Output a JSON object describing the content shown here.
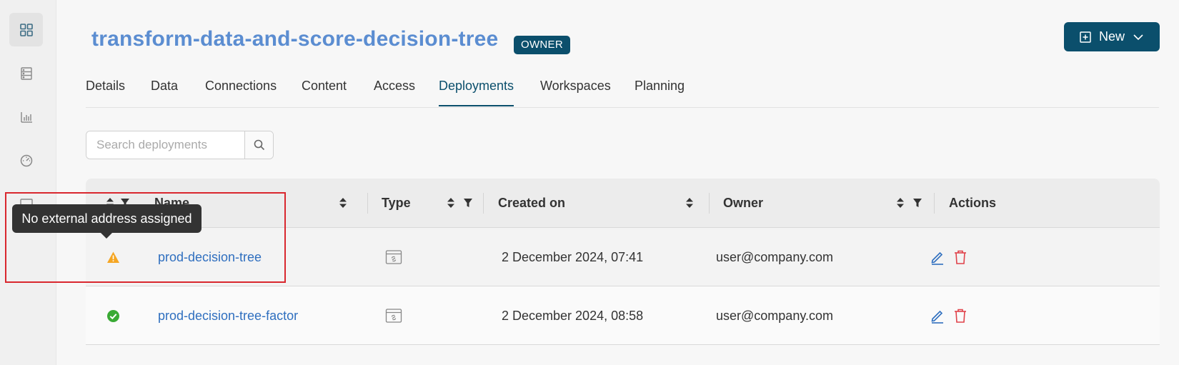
{
  "sidebar": {
    "items": [
      {
        "icon": "dashboard-grid-icon",
        "active": true
      },
      {
        "icon": "server-list-icon",
        "active": false
      },
      {
        "icon": "bar-chart-icon",
        "active": false
      },
      {
        "icon": "gauge-icon",
        "active": false
      },
      {
        "icon": "monitor-icon",
        "active": false
      }
    ]
  },
  "header": {
    "title": "transform-data-and-score-decision-tree",
    "badge": "OWNER",
    "new_button": "New"
  },
  "tabs": [
    {
      "label": "Details"
    },
    {
      "label": "Data"
    },
    {
      "label": "Connections"
    },
    {
      "label": "Content"
    },
    {
      "label": "Access"
    },
    {
      "label": "Deployments",
      "active": true
    },
    {
      "label": "Workspaces"
    },
    {
      "label": "Planning"
    }
  ],
  "search": {
    "placeholder": "Search deployments"
  },
  "table": {
    "columns": {
      "name": "Name",
      "type": "Type",
      "created": "Created on",
      "owner": "Owner",
      "actions": "Actions"
    },
    "rows": [
      {
        "status": "warning",
        "name": "prod-decision-tree",
        "type_icon": "web-service-icon",
        "created": "2 December 2024, 07:41",
        "owner": "user@company.com"
      },
      {
        "status": "ok",
        "name": "prod-decision-tree-factor",
        "type_icon": "web-service-icon",
        "created": "2 December 2024, 08:58",
        "owner": "user@company.com"
      }
    ]
  },
  "tooltip": {
    "text": "No external address assigned"
  },
  "colors": {
    "brand": "#0b4f6c",
    "title": "#5b8dd1",
    "link": "#2f6fbf",
    "warning": "#f5a623",
    "success": "#3aaa35",
    "danger": "#e0424a",
    "highlight": "#d9272e"
  }
}
